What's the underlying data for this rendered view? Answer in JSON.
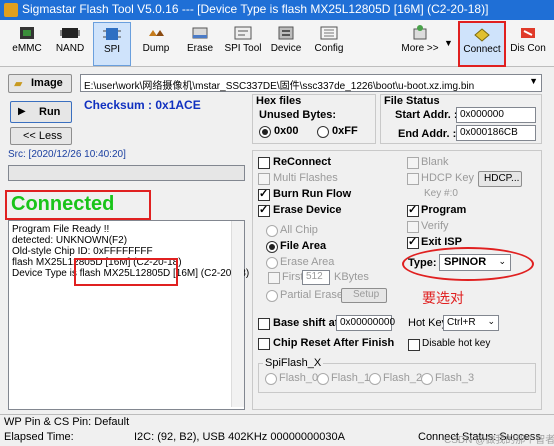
{
  "window": {
    "title": "Sigmastar Flash Tool V5.0.16 --- [Device Type is flash MX25L12805D [16M] (C2-20-18)]"
  },
  "toolbar": {
    "emmc": "eMMC",
    "nand": "NAND",
    "spi": "SPI",
    "dump": "Dump",
    "erase": "Erase",
    "spitool": "SPI Tool",
    "device": "Device",
    "config": "Config",
    "more": "More >>",
    "connect": "Connect",
    "disconnect": "Dis Con"
  },
  "left": {
    "image_label": "Image",
    "run_label": "Run",
    "less_label": "<< Less",
    "checksum": "Checksum : 0x1ACE",
    "src": "Src: [2020/12/26 10:40:20]",
    "connected": "Connected",
    "log": [
      "Program File Ready !!",
      "detected: UNKNOWN(F2)",
      "Old-style Chip ID: 0xFFFFFFFF",
      "flash MX25L12805D [16M] (C2-20-18)",
      "Device Type is flash MX25L12805D [16M] (C2-20-18)"
    ]
  },
  "path": {
    "value": "E:\\user\\work\\网络摄像机\\mstar_SSC337DE\\固件\\ssc337de_1226\\boot\\u-boot.xz.img.bin"
  },
  "hexfiles": {
    "title": "Hex files",
    "unused_label": "Unused Bytes:",
    "opt_00": "0x00",
    "opt_ff": "0xFF"
  },
  "filestatus": {
    "title": "File Status",
    "start_label": "Start Addr. :",
    "start_value": "0x000000",
    "end_label": "End Addr. :",
    "end_value": "0x000186CB"
  },
  "options": {
    "reconnect": "ReConnect",
    "multi_flashes": "Multi Flashes",
    "burn_run_flow": "Burn Run Flow",
    "erase_device": "Erase Device",
    "all_chip": "All Chip",
    "file_area": "File Area",
    "erase_area": "Erase Area",
    "first": "First",
    "first_value": "512",
    "kbytes": "KBytes",
    "partial_erase": "Partial Erase",
    "setup": "Setup",
    "base_shift": "Base shift at",
    "base_shift_value": "0x00000000",
    "chip_reset": "Chip Reset After Finish"
  },
  "right": {
    "blank": "Blank",
    "hdcp_key": "HDCP Key",
    "hdcp_btn": "HDCP...",
    "key_no": "Key #:0",
    "program": "Program",
    "verify": "Verify",
    "exit_isp": "Exit ISP",
    "type_label": "Type:",
    "type_value": "SPINOR",
    "annotation": "要选对",
    "hotkey_label": "Hot Key",
    "hotkey_value": "Ctrl+R",
    "disable_hotkey": "Disable hot key"
  },
  "spiflash": {
    "title": "SpiFlash_X",
    "items": [
      "Flash_0",
      "Flash_1",
      "Flash_2",
      "Flash_3"
    ]
  },
  "statusbar": {
    "wp": "WP Pin & CS Pin: Default",
    "elapsed": "Elapsed Time:",
    "i2c": "I2C: (92, B2), USB  402KHz  00000000030A",
    "connect_status": "Connect Status: Success",
    "watermark": "CSDN @做我的那个智者"
  },
  "colors": {
    "accent": "#1f6fd6",
    "connected": "#19c419",
    "annotation": "#e02020",
    "checksum": "#1030c0"
  }
}
